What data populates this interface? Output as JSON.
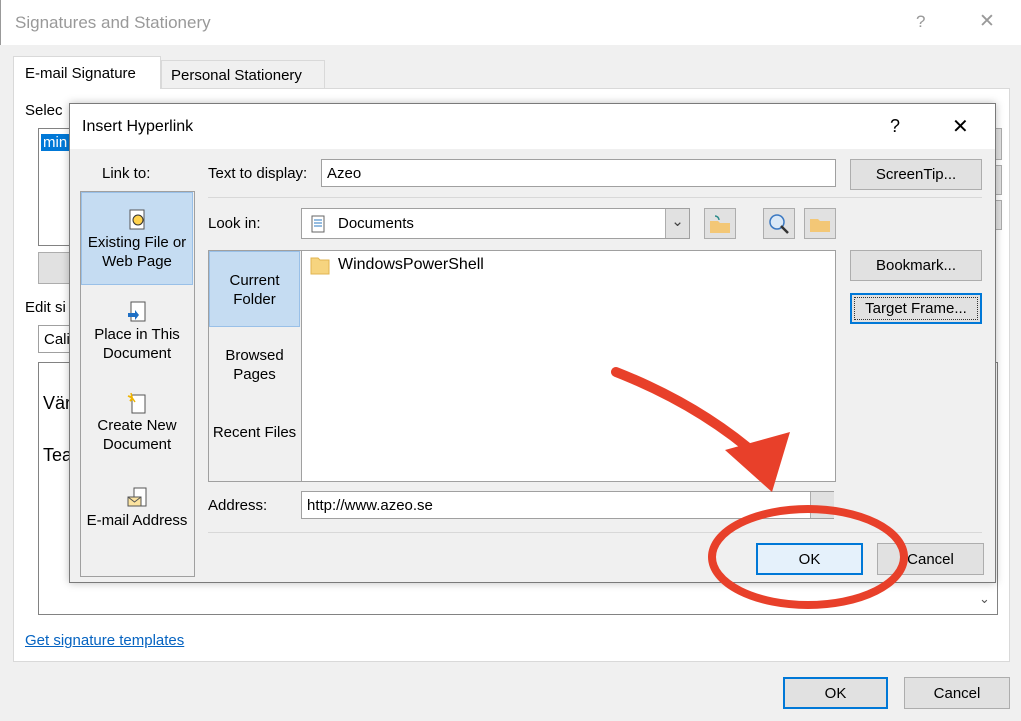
{
  "outer": {
    "title": "Signatures and Stationery",
    "help": "?",
    "close": "✕",
    "tabs": [
      {
        "label": "E-mail Signature"
      },
      {
        "label": "Personal Stationery"
      }
    ],
    "select_label": "Selec",
    "selected_sig": "min",
    "edit_label": "Edit si",
    "font_value": "Cali",
    "editor_lines": [
      "Vär",
      "Tea"
    ],
    "templates_link": "Get signature templates",
    "ok": "OK",
    "cancel": "Cancel"
  },
  "dialog": {
    "title": "Insert Hyperlink",
    "help": "?",
    "close": "✕",
    "link_to_label": "Link to:",
    "link_to": [
      {
        "label": "Existing File or Web Page",
        "icon": "web-page-icon",
        "selected": true
      },
      {
        "label": "Place in This Document",
        "icon": "place-document-icon"
      },
      {
        "label": "Create New Document",
        "icon": "new-document-icon"
      },
      {
        "label": "E-mail Address",
        "icon": "email-icon"
      }
    ],
    "text_to_display_label": "Text to display:",
    "text_to_display": "Azeo",
    "screentip": "ScreenTip...",
    "look_in_label": "Look in:",
    "look_in": "Documents",
    "places": [
      {
        "label": "Current Folder",
        "selected": true
      },
      {
        "label": "Browsed Pages"
      },
      {
        "label": "Recent Files"
      }
    ],
    "files": [
      {
        "name": "WindowsPowerShell",
        "icon": "folder-icon"
      }
    ],
    "bookmark": "Bookmark...",
    "target_frame": "Target Frame...",
    "address_label": "Address:",
    "address": "http://www.azeo.se",
    "ok": "OK",
    "cancel": "Cancel"
  },
  "annotation": {
    "color": "#e8402a"
  }
}
